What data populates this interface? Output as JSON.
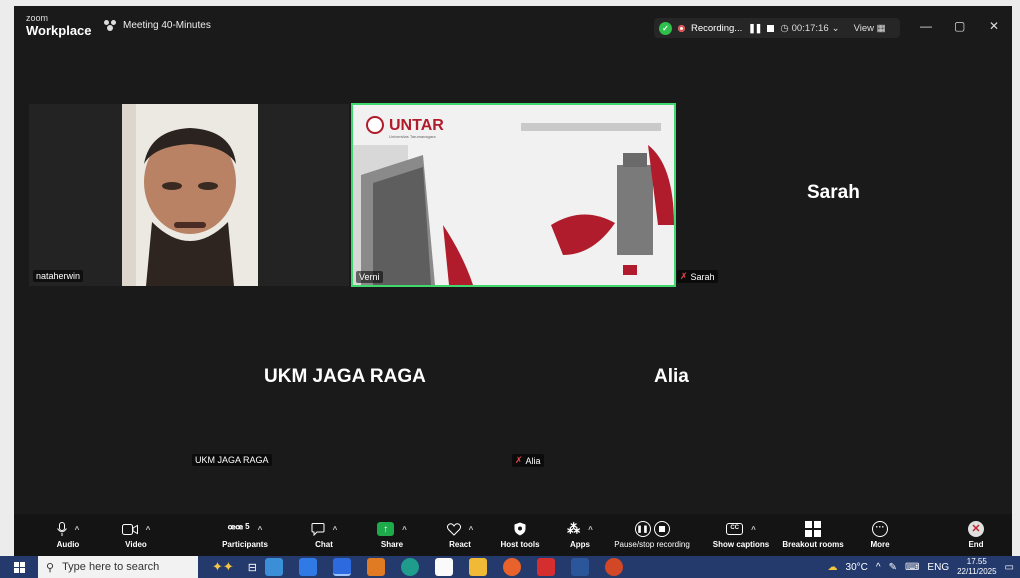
{
  "app": {
    "logo_small": "zoom",
    "logo_main": "Workplace",
    "meeting_title": "Meeting 40-Minutes",
    "recording_label": "Recording...",
    "timer": "00:17:16",
    "view_label": "View"
  },
  "tiles": {
    "natahherwin": {
      "name": "nataherwin"
    },
    "verni": {
      "name": "Verni",
      "slide_brand": "UNTAR",
      "slide_sub": "Universitas Tarumanagara"
    },
    "sarah": {
      "big": "Sarah",
      "name": "Sarah"
    },
    "ukm": {
      "big": "UKM JAGA RAGA",
      "name": "UKM JAGA RAGA"
    },
    "alia": {
      "big": "Alia",
      "name": "Alia"
    }
  },
  "toolbar": {
    "audio": "Audio",
    "video": "Video",
    "participants": "Participants",
    "participants_count": "5",
    "chat": "Chat",
    "share": "Share",
    "react": "React",
    "host_tools": "Host tools",
    "apps": "Apps",
    "pause_stop": "Pause/stop recording",
    "show_captions": "Show captions",
    "breakout": "Breakout rooms",
    "more": "More",
    "end": "End"
  },
  "taskbar": {
    "search_placeholder": "Type here to search",
    "temperature": "30°C",
    "lang": "ENG",
    "time": "17.55",
    "date": "22/11/2025"
  },
  "colors": {
    "active_speaker_border": "#3fd76e",
    "untar_red": "#b01c2b",
    "share_green": "#1ea94a",
    "taskbar": "#243a6d"
  }
}
